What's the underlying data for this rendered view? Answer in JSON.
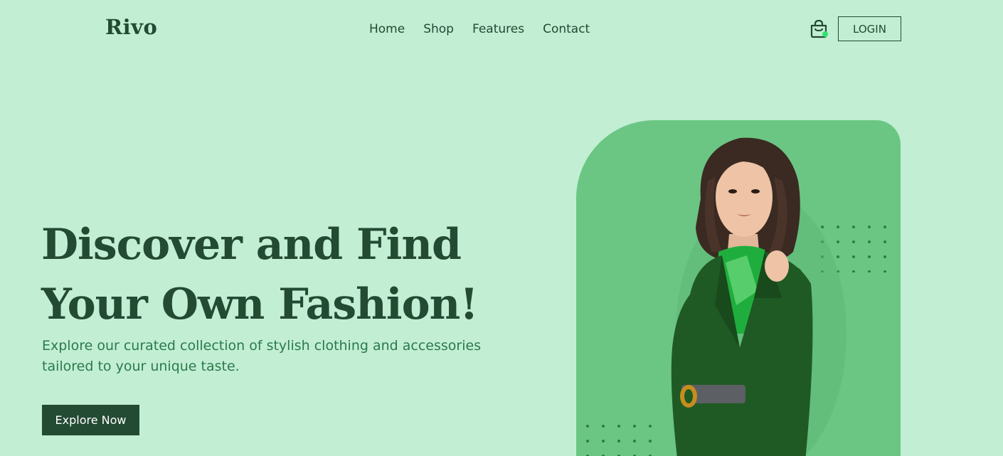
{
  "brand": {
    "logo": "Rivo"
  },
  "nav": {
    "items": [
      {
        "label": "Home"
      },
      {
        "label": "Shop"
      },
      {
        "label": "Features"
      },
      {
        "label": "Contact"
      }
    ]
  },
  "header": {
    "cart_icon": "shopping-bag-icon",
    "login_label": "LOGIN"
  },
  "hero": {
    "title_line1": "Discover and Find",
    "title_line2": "Your Own Fashion!",
    "subtitle_line1": "Explore our curated collection of stylish clothing and accessories",
    "subtitle_line2": "tailored to your unique taste.",
    "cta_label": "Explore Now",
    "image_icon": "fashion-model-photo"
  },
  "colors": {
    "background": "#c2eed4",
    "primary": "#234a33",
    "accent_text": "#2a7a4b",
    "panel": "#6bc683",
    "cart_badge": "#2ee56a"
  }
}
